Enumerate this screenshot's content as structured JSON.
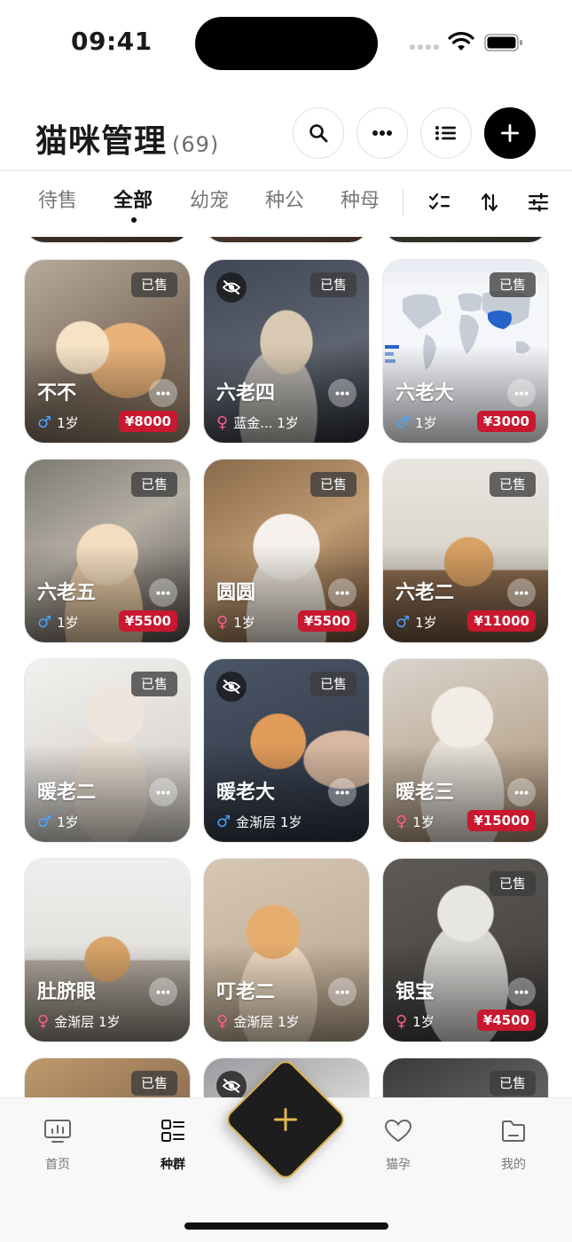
{
  "status": {
    "time": "09:41"
  },
  "header": {
    "title": "猫咪管理",
    "count": "(69)"
  },
  "tabs": [
    {
      "label": "待售",
      "active": false
    },
    {
      "label": "全部",
      "active": true
    },
    {
      "label": "幼宠",
      "active": false
    },
    {
      "label": "种公",
      "active": false
    },
    {
      "label": "种母",
      "active": false
    }
  ],
  "colors": {
    "accent": "#000000",
    "price_badge": "#c9182f",
    "male": "#4aa3ff",
    "female": "#ff5c8a",
    "fab_border": "#d8b24a"
  },
  "cats": [
    {
      "name": "不不",
      "gender": "male",
      "gender_symbol": "♂",
      "info": "1岁",
      "price": "¥8000",
      "sold_label": "已售",
      "hidden": false,
      "photo": "cream-cat-lying"
    },
    {
      "name": "六老四",
      "gender": "female",
      "gender_symbol": "♀",
      "info": "蓝金... 1岁",
      "price": "",
      "sold_label": "已售",
      "hidden": true,
      "photo": "silver-gold-kitten"
    },
    {
      "name": "六老大",
      "gender": "male",
      "gender_symbol": "♂",
      "info": "1岁",
      "price": "¥3000",
      "sold_label": "已售",
      "hidden": false,
      "photo": "world-map-screenshot"
    },
    {
      "name": "六老五",
      "gender": "male",
      "gender_symbol": "♂",
      "info": "1岁",
      "price": "¥5500",
      "sold_label": "已售",
      "hidden": false,
      "photo": "cream-kitten"
    },
    {
      "name": "圆圆",
      "gender": "female",
      "gender_symbol": "♀",
      "info": "1岁",
      "price": "¥5500",
      "sold_label": "已售",
      "hidden": false,
      "photo": "white-fluffy-kitten"
    },
    {
      "name": "六老二",
      "gender": "male",
      "gender_symbol": "♂",
      "info": "1岁",
      "price": "¥11000",
      "sold_label": "已售",
      "hidden": false,
      "photo": "golden-cat-on-table"
    },
    {
      "name": "暖老二",
      "gender": "male",
      "gender_symbol": "♂",
      "info": "1岁",
      "price": "",
      "sold_label": "已售",
      "hidden": false,
      "photo": "white-cat-sitting"
    },
    {
      "name": "暖老大",
      "gender": "male",
      "gender_symbol": "♂",
      "info": "金渐层 1岁",
      "price": "",
      "sold_label": "已售",
      "hidden": true,
      "photo": "orange-kitten-hand"
    },
    {
      "name": "暖老三",
      "gender": "female",
      "gender_symbol": "♀",
      "info": "1岁",
      "price": "¥15000",
      "sold_label": "",
      "hidden": false,
      "photo": "silver-fluffy-cat"
    },
    {
      "name": "肚脐眼",
      "gender": "female",
      "gender_symbol": "♀",
      "info": "金渐层 1岁",
      "price": "",
      "sold_label": "",
      "hidden": false,
      "photo": "golden-cat-shelf"
    },
    {
      "name": "叮老二",
      "gender": "female",
      "gender_symbol": "♀",
      "info": "金渐层 1岁",
      "price": "",
      "sold_label": "",
      "hidden": false,
      "photo": "golden-cat-paw-up"
    },
    {
      "name": "银宝",
      "gender": "female",
      "gender_symbol": "♀",
      "info": "1岁",
      "price": "¥4500",
      "sold_label": "已售",
      "hidden": false,
      "photo": "silver-cat-fluffy"
    },
    {
      "name": "",
      "gender": "",
      "gender_symbol": "",
      "info": "",
      "price": "",
      "sold_label": "已售",
      "hidden": false,
      "photo": "tabby-partial"
    },
    {
      "name": "",
      "gender": "",
      "gender_symbol": "",
      "info": "",
      "price": "",
      "sold_label": "",
      "hidden": true,
      "photo": "white-cat-partial"
    },
    {
      "name": "",
      "gender": "",
      "gender_symbol": "",
      "info": "",
      "price": "",
      "sold_label": "已售",
      "hidden": false,
      "photo": "dark-partial"
    }
  ],
  "nav": [
    {
      "label": "首页",
      "icon": "monitor-chart-icon",
      "active": false
    },
    {
      "label": "种群",
      "icon": "grid-list-icon",
      "active": true
    },
    {
      "label": "猫孕",
      "icon": "heart-icon",
      "active": false
    },
    {
      "label": "我的",
      "icon": "folder-icon",
      "active": false
    }
  ]
}
